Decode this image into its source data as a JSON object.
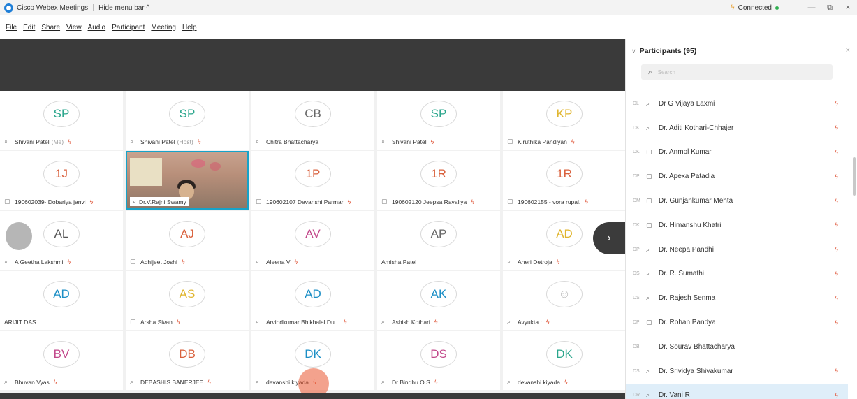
{
  "titlebar": {
    "app_title": "Cisco Webex Meetings",
    "hide_menu": "Hide menu bar ^",
    "status": "Connected",
    "minimize": "—",
    "restore": "⧉",
    "close": "×"
  },
  "menu": {
    "items": [
      "File",
      "Edit",
      "Share",
      "View",
      "Audio",
      "Participant",
      "Meeting",
      "Help"
    ]
  },
  "grid": {
    "rows": [
      [
        {
          "initials": "SP",
          "color": "#2aa68c",
          "name": "Shivani Patel",
          "suffix": "(Me)",
          "device": "phone",
          "mic": true
        },
        {
          "initials": "SP",
          "color": "#2aa68c",
          "name": "Shivani Patel",
          "suffix": "(Host)",
          "device": "phone",
          "mic": true
        },
        {
          "initials": "CB",
          "color": "#666666",
          "name": "Chitra Bhattacharya",
          "suffix": "",
          "device": "phone",
          "mic": false
        },
        {
          "initials": "SP",
          "color": "#2aa68c",
          "name": "Shivani Patel",
          "suffix": "",
          "device": "phone",
          "mic": true
        },
        {
          "initials": "KP",
          "color": "#e0b52e",
          "name": "Kiruthika Pandiyan",
          "suffix": "",
          "device": "screen",
          "mic": true
        }
      ],
      [
        {
          "initials": "1J",
          "color": "#d9603c",
          "name": "190602039- Dobariya janvi",
          "suffix": "",
          "device": "screen",
          "mic": true
        },
        {
          "video": true,
          "name": "Dr.V.Rajni Swamy",
          "device": "phone"
        },
        {
          "initials": "1P",
          "color": "#d9603c",
          "name": "190602107 Devanshi Parmar",
          "suffix": "",
          "device": "screen",
          "mic": true
        },
        {
          "initials": "1R",
          "color": "#d9603c",
          "name": "190602120 Jeepsa Ravaliya",
          "suffix": "",
          "device": "screen",
          "mic": true
        },
        {
          "initials": "1R",
          "color": "#d9603c",
          "name": "190602155 - vora rupal.",
          "suffix": "",
          "device": "screen",
          "mic": true
        }
      ],
      [
        {
          "initials": "AL",
          "color": "#555555",
          "name": "A Geetha Lakshmi",
          "suffix": "",
          "device": "phone",
          "mic": true
        },
        {
          "initials": "AJ",
          "color": "#d9603c",
          "name": "Abhijeet Joshi",
          "suffix": "",
          "device": "screen",
          "mic": true
        },
        {
          "initials": "AV",
          "color": "#c2478a",
          "name": "Aleena V",
          "suffix": "",
          "device": "phone",
          "mic": true
        },
        {
          "initials": "AP",
          "color": "#666666",
          "name": "Amisha Patel",
          "suffix": "",
          "device": "none",
          "mic": false
        },
        {
          "initials": "AD",
          "color": "#e0b52e",
          "name": "Aneri Detroja",
          "suffix": "",
          "device": "phone",
          "mic": true
        }
      ],
      [
        {
          "initials": "AD",
          "color": "#1c8fc6",
          "name": "ARIJIT DAS",
          "suffix": "",
          "device": "none",
          "mic": false
        },
        {
          "initials": "AS",
          "color": "#e0b52e",
          "name": "Arsha Sivan",
          "suffix": "",
          "device": "screen",
          "mic": true
        },
        {
          "initials": "AD",
          "color": "#1c8fc6",
          "name": "Arvindkumar Bhikhalal Du...",
          "suffix": "",
          "device": "phone",
          "mic": true
        },
        {
          "initials": "AK",
          "color": "#1c8fc6",
          "name": "Ashish Kothari",
          "suffix": "",
          "device": "phone",
          "mic": true
        },
        {
          "initials": "☺",
          "color": "#bbbbbb",
          "name": "Avyukta :",
          "suffix": "",
          "device": "phone",
          "mic": true
        }
      ],
      [
        {
          "initials": "BV",
          "color": "#c2478a",
          "name": "Bhuvan Vyas",
          "suffix": "",
          "device": "phone",
          "mic": true
        },
        {
          "initials": "DB",
          "color": "#d9603c",
          "name": "DEBASHIS BANERJEE",
          "suffix": "",
          "device": "phone",
          "mic": true
        },
        {
          "initials": "DK",
          "color": "#1c8fc6",
          "name": "devanshi kiyada",
          "suffix": "",
          "device": "phone",
          "mic": true
        },
        {
          "initials": "DS",
          "color": "#c2478a",
          "name": "Dr Bindhu O S",
          "suffix": "",
          "device": "phone",
          "mic": true
        },
        {
          "initials": "DK",
          "color": "#2aa68c",
          "name": "devanshi kiyada",
          "suffix": "",
          "device": "phone",
          "mic": true
        }
      ]
    ]
  },
  "panel": {
    "title": "Participants (95)",
    "close": "×",
    "search_placeholder": "Search",
    "participants": [
      {
        "initials": "DL",
        "device": "phone",
        "name": "Dr G Vijaya Laxmi",
        "mic": true
      },
      {
        "initials": "DK",
        "device": "phone",
        "name": "Dr. Aditi Kothari-Chhajer",
        "mic": true
      },
      {
        "initials": "DK",
        "device": "screen",
        "name": "Dr. Anmol Kumar",
        "mic": true
      },
      {
        "initials": "DP",
        "device": "screen",
        "name": "Dr. Apexa Patadia",
        "mic": true
      },
      {
        "initials": "DM",
        "device": "screen",
        "name": "Dr. Gunjankumar Mehta",
        "mic": true
      },
      {
        "initials": "DK",
        "device": "screen",
        "name": "Dr. Himanshu Khatri",
        "mic": true
      },
      {
        "initials": "DP",
        "device": "phone",
        "name": "Dr. Neepa Pandhi",
        "mic": true
      },
      {
        "initials": "DS",
        "device": "phone",
        "name": "Dr. R. Sumathi",
        "mic": true
      },
      {
        "initials": "DS",
        "device": "phone",
        "name": "Dr. Rajesh Senma",
        "mic": true
      },
      {
        "initials": "DP",
        "device": "screen",
        "name": "Dr. Rohan Pandya",
        "mic": true
      },
      {
        "initials": "DB",
        "device": "none",
        "name": "Dr. Sourav Bhattacharya",
        "mic": false
      },
      {
        "initials": "DS",
        "device": "phone",
        "name": "Dr. Srividya Shivakumar",
        "mic": true
      },
      {
        "initials": "DR",
        "device": "phone",
        "name": "Dr. Vani R",
        "mic": true,
        "selected": true
      }
    ]
  }
}
